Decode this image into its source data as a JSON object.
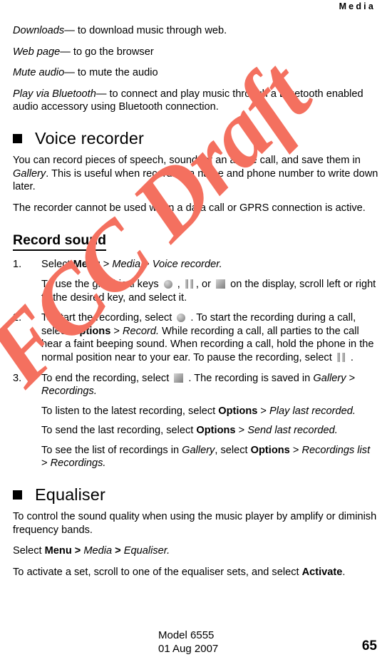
{
  "header": {
    "running_title": "Media"
  },
  "watermark": {
    "line1": "FCC Draft",
    "color": "#f4705f"
  },
  "icons": {
    "record": "record-circle-icon",
    "pause": "pause-bars-icon",
    "stop": "stop-square-icon",
    "bullet": "black-square-bullet-icon"
  },
  "intro": {
    "items": [
      {
        "term": "Downloads",
        "dash": "—",
        "desc": " to download music through web."
      },
      {
        "term": "Web page",
        "dash": "—",
        "desc": " to go the browser"
      },
      {
        "term": "Mute audio",
        "dash": "—",
        "desc": " to mute the audio"
      },
      {
        "term": "Play via Bluetooth",
        "dash": "—",
        "desc": " to connect and play music through a Bluetooth enabled audio accessory using Bluetooth connection."
      }
    ]
  },
  "voice_recorder": {
    "heading": "Voice recorder",
    "p1_a": "You can record pieces of speech, sound, or an active call, and save them in ",
    "p1_gallery": "Gallery",
    "p1_b": ". This is useful when recording a name and phone number to write down later.",
    "p2": "The recorder cannot be used when a data call or GPRS connection is active.",
    "record_sound": {
      "subheading": "Record sound",
      "steps": [
        {
          "num": "1.",
          "lines": [
            {
              "segments": [
                {
                  "t": "Select ",
                  "s": "n"
                },
                {
                  "t": "Menu",
                  "s": "b"
                },
                {
                  "t": " > ",
                  "s": "n"
                },
                {
                  "t": "Media",
                  "s": "i"
                },
                {
                  "t": " > ",
                  "s": "n"
                },
                {
                  "t": "Voice recorder.",
                  "s": "i"
                }
              ]
            },
            {
              "segments": [
                {
                  "t": "To use the graphical keys ",
                  "s": "n"
                },
                {
                  "t": "",
                  "s": "icon-record"
                },
                {
                  "t": " , ",
                  "s": "n"
                },
                {
                  "t": "",
                  "s": "icon-pause"
                },
                {
                  "t": ", or ",
                  "s": "n"
                },
                {
                  "t": "",
                  "s": "icon-stop"
                },
                {
                  "t": " on the display, scroll left or right to the desired key, and select it.",
                  "s": "n"
                }
              ]
            }
          ]
        },
        {
          "num": "2.",
          "lines": [
            {
              "segments": [
                {
                  "t": "To start the recording, select ",
                  "s": "n"
                },
                {
                  "t": "",
                  "s": "icon-record"
                },
                {
                  "t": " . To start the recording during a call, select ",
                  "s": "n"
                },
                {
                  "t": "Options",
                  "s": "b"
                },
                {
                  "t": " > ",
                  "s": "n"
                },
                {
                  "t": "Record.",
                  "s": "i"
                },
                {
                  "t": " While recording a call, all parties to the call hear a faint beeping sound. When recording a call, hold the phone in the normal position near to your ear. To pause the recording, select ",
                  "s": "n"
                },
                {
                  "t": "",
                  "s": "icon-pause"
                },
                {
                  "t": " .",
                  "s": "n"
                }
              ]
            }
          ]
        },
        {
          "num": "3.",
          "lines": [
            {
              "segments": [
                {
                  "t": "To end the recording, select ",
                  "s": "n"
                },
                {
                  "t": "",
                  "s": "icon-stop"
                },
                {
                  "t": " . The recording is saved in ",
                  "s": "n"
                },
                {
                  "t": "Gallery",
                  "s": "i"
                },
                {
                  "t": " > ",
                  "s": "n"
                },
                {
                  "t": "Recordings.",
                  "s": "i"
                }
              ]
            },
            {
              "segments": [
                {
                  "t": "To listen to the latest recording, select ",
                  "s": "n"
                },
                {
                  "t": "Options",
                  "s": "b"
                },
                {
                  "t": " > ",
                  "s": "n"
                },
                {
                  "t": "Play last recorded.",
                  "s": "i"
                }
              ]
            },
            {
              "segments": [
                {
                  "t": "To send the last recording, select ",
                  "s": "n"
                },
                {
                  "t": "Options",
                  "s": "b"
                },
                {
                  "t": " > ",
                  "s": "n"
                },
                {
                  "t": "Send last recorded.",
                  "s": "i"
                }
              ]
            },
            {
              "segments": [
                {
                  "t": "To see the list of recordings in ",
                  "s": "n"
                },
                {
                  "t": "Gallery",
                  "s": "i"
                },
                {
                  "t": ", select ",
                  "s": "n"
                },
                {
                  "t": "Options",
                  "s": "b"
                },
                {
                  "t": " > ",
                  "s": "n"
                },
                {
                  "t": "Recordings list",
                  "s": "i"
                },
                {
                  "t": " > ",
                  "s": "n"
                },
                {
                  "t": "Recordings.",
                  "s": "i"
                }
              ]
            }
          ]
        }
      ]
    }
  },
  "equaliser": {
    "heading": "Equaliser",
    "p1": "To control the sound quality when using the music player by amplify or diminish frequency bands.",
    "p2_segments": [
      {
        "t": "Select ",
        "s": "n"
      },
      {
        "t": "Menu",
        "s": "b"
      },
      {
        "t": " > ",
        "s": "b"
      },
      {
        "t": "Media",
        "s": "i"
      },
      {
        "t": " > ",
        "s": "b"
      },
      {
        "t": "Equaliser.",
        "s": "i"
      }
    ],
    "p3_segments": [
      {
        "t": "To activate a set, scroll to one of the equaliser sets, and select ",
        "s": "n"
      },
      {
        "t": "Activate",
        "s": "b"
      },
      {
        "t": ".",
        "s": "n"
      }
    ]
  },
  "footer": {
    "model": "Model 6555",
    "date": "01 Aug 2007",
    "page_number": "65"
  }
}
